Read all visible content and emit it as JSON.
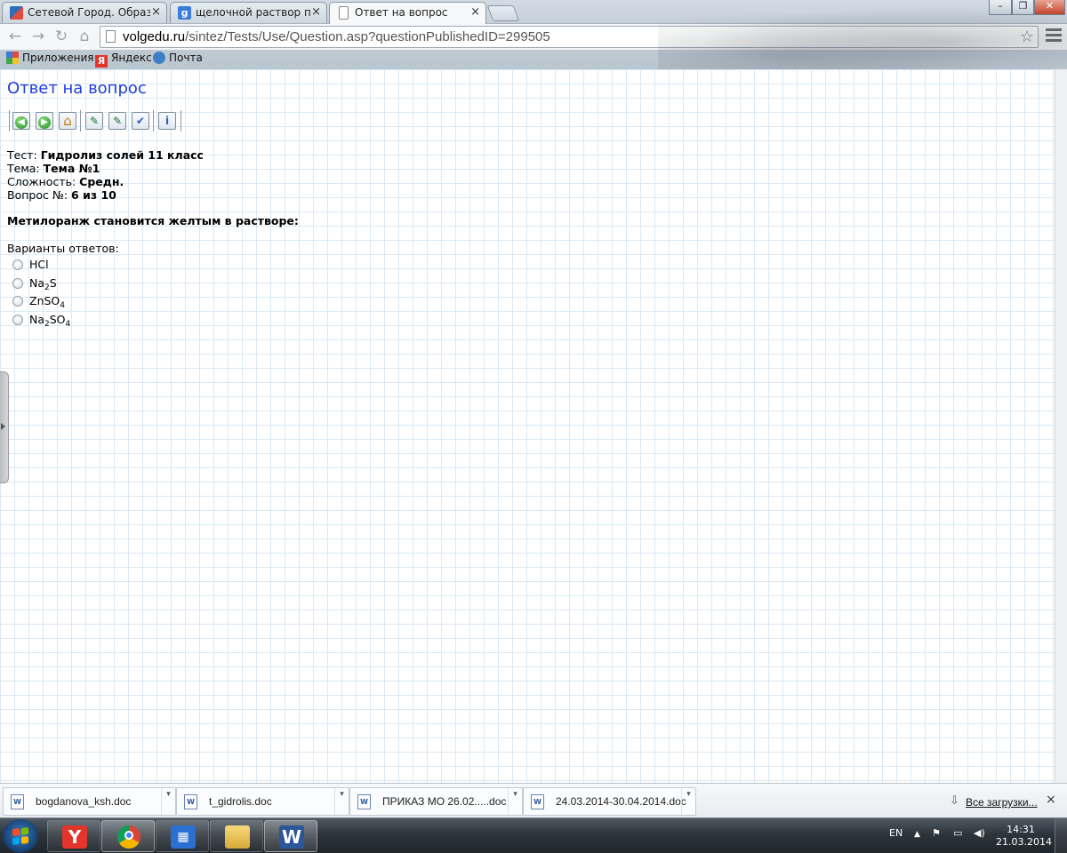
{
  "browser": {
    "tabs": [
      {
        "title": "Сетевой Город. Образов",
        "close": "×"
      },
      {
        "title": "щелочной раствор полу",
        "close": "×"
      },
      {
        "title": "Ответ на вопрос",
        "close": "×"
      }
    ],
    "url_host": "volgedu.ru",
    "url_path": "/sintez/Tests/Use/Question.asp?questionPublishedID=299505",
    "bookmarks": [
      "Приложения",
      "Яндекс",
      "Почта"
    ],
    "window_buttons": [
      "–",
      "❐",
      "✕"
    ]
  },
  "page": {
    "title": "Ответ на вопрос",
    "test_label": "Тест:",
    "test_value": "Гидролиз солей 11 класс",
    "topic_label": "Тема:",
    "topic_value": "Тема №1",
    "difficulty_label": "Сложность:",
    "difficulty_value": "Средн.",
    "question_label": "Вопрос №:",
    "question_value": "6 из 10",
    "question_text": "Метилоранж становится желтым в растворе:",
    "answers_label": "Варианты ответов:",
    "options": [
      {
        "main": "HCl"
      },
      {
        "main": "Na",
        "sub1": "2",
        "rest": "S"
      },
      {
        "main": "ZnSO",
        "sub1": "4"
      },
      {
        "main": "Na",
        "sub1": "2",
        "rest": "SO",
        "sub2": "4"
      }
    ]
  },
  "downloads": {
    "files": [
      "bogdanova_ksh.doc",
      "t_gidrolis.doc",
      "ПРИКАЗ МО 26.02.....doc",
      "24.03.2014-30.04.2014.doc"
    ],
    "all_label": "Все загрузки...",
    "close": "×"
  },
  "taskbar": {
    "language": "EN",
    "time": "14:31",
    "date": "21.03.2014",
    "apps": [
      "yandex-browser",
      "chrome",
      "metro-app",
      "explorer",
      "word"
    ]
  },
  "colors": {
    "page_title": "#1f3cde",
    "grid_line": "#dbe9f4",
    "taskbar": "#2d353c"
  }
}
